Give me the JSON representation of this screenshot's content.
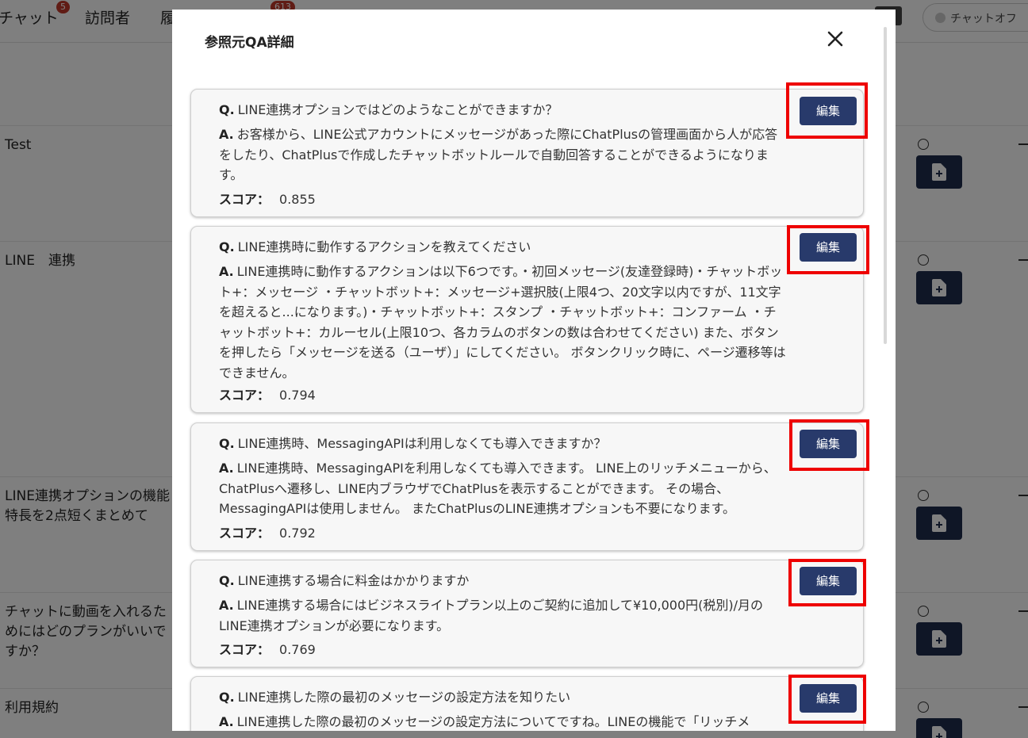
{
  "topnav": {
    "chat_label": "チャット",
    "chat_badge": "5",
    "visitors_label": "訪問者",
    "history_label": "履",
    "history_badge": "613",
    "status_label": "チャットオフ"
  },
  "table_rows": [
    {
      "text": "Test"
    },
    {
      "text": "LINE　連携"
    },
    {
      "text": "LINE連携オプションの機能特長を2点短くまとめて"
    },
    {
      "text": "チャットに動画を入れるためにはどのプランがいいですか？"
    },
    {
      "text": "利用規約"
    }
  ],
  "modal": {
    "title": "参照元QA詳細",
    "q_prefix": "Q.",
    "a_prefix": "A.",
    "score_label": "スコア：",
    "edit_label": "編集",
    "items": [
      {
        "question": "LINE連携オプションではどのようなことができますか？",
        "answer": "お客様から、LINE公式アカウントにメッセージがあった際にChatPlusの管理画面から人が応答をしたり、ChatPlusで作成したチャットボットルールで自動回答することができるようになります。",
        "score": "0.855"
      },
      {
        "question": "LINE連携時に動作するアクションを教えてください",
        "answer": "LINE連携時に動作するアクションは以下6つです。・初回メッセージ(友達登録時)・チャットボット+：メッセージ ・チャットボット+：メッセージ+選択肢(上限4つ、20文字以内ですが、11文字を超えると...になります。)・チャットボット+：スタンプ ・チャットボット+：コンファーム ・チャットボット+：カルーセル(上限10つ、各カラムのボタンの数は合わせてください) また、ボタンを押したら「メッセージを送る（ユーザ）」にしてください。 ボタンクリック時に、ページ遷移等はできません。",
        "score": "0.794"
      },
      {
        "question": "LINE連携時、MessagingAPIは利用しなくても導入できますか？",
        "answer": "LINE連携時、MessagingAPIを利用しなくても導入できます。 LINE上のリッチメニューから、ChatPlusへ遷移し、LINE内ブラウザでChatPlusを表示することができます。 その場合、MessagingAPIは使用しません。 またChatPlusのLINE連携オプションも不要になります。",
        "score": "0.792"
      },
      {
        "question": "LINE連携する場合に料金はかかりますか",
        "answer": "LINE連携する場合にはビジネスライトプラン以上のご契約に追加して¥10,000円(税別)/月のLINE連携オプションが必要になります。",
        "score": "0.769"
      },
      {
        "question": "LINE連携した際の最初のメッセージの設定方法を知りたい",
        "answer": "LINE連携した際の最初のメッセージの設定方法についてですね。LINEの機能で「リッチメ",
        "score": ""
      }
    ]
  },
  "colors": {
    "primary_button": "#283a6b",
    "highlight": "#ee0000",
    "row_button": "#1f2d4d",
    "badge": "#c0392b"
  },
  "icons": [
    "close-icon",
    "file-plus-icon"
  ]
}
